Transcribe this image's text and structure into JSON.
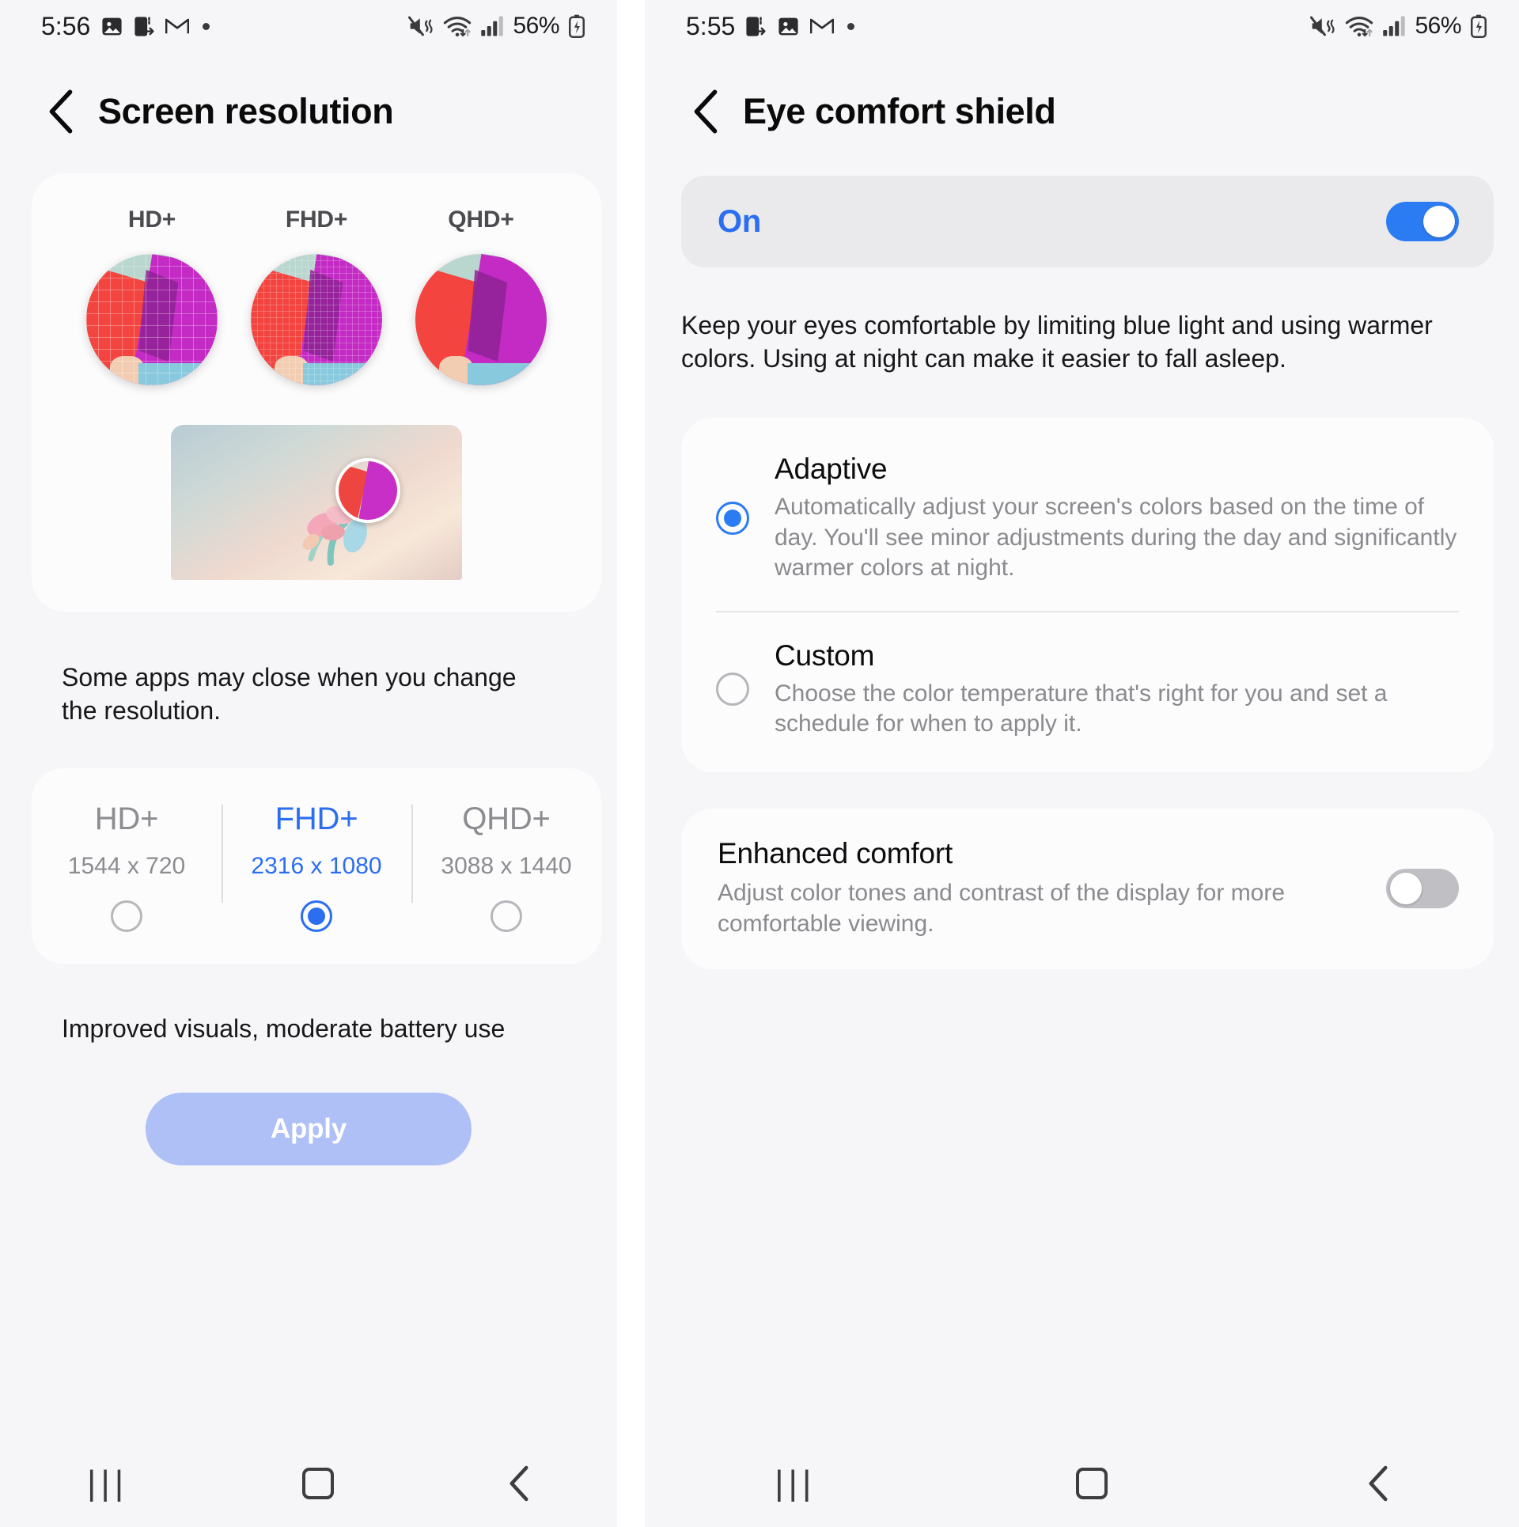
{
  "left": {
    "status_bar": {
      "time": "5:56",
      "icons": [
        "photos-icon",
        "file-transfer-icon",
        "gmail-icon",
        "dot-icon"
      ],
      "right_icons": [
        "mute-vibrate-icon",
        "wifi-icon",
        "signal-icon"
      ],
      "battery": "56%"
    },
    "header": {
      "back": "back-chevron",
      "title": "Screen resolution"
    },
    "previews": [
      {
        "label": "HD+",
        "quality": "hd"
      },
      {
        "label": "FHD+",
        "quality": "fhd"
      },
      {
        "label": "QHD+",
        "quality": "qhd"
      }
    ],
    "notice": "Some apps may close when you change the resolution.",
    "resolutions": [
      {
        "name": "HD+",
        "dims": "1544 x 720",
        "selected": false
      },
      {
        "name": "FHD+",
        "dims": "2316 x 1080",
        "selected": true
      },
      {
        "name": "QHD+",
        "dims": "3088 x 1440",
        "selected": false
      }
    ],
    "hint": "Improved visuals, moderate battery use",
    "apply_label": "Apply",
    "nav": {
      "recents": "|||",
      "home": "home-square",
      "back": "back-chevron"
    }
  },
  "right": {
    "status_bar": {
      "time": "5:55",
      "icons": [
        "file-transfer-icon",
        "photos-icon",
        "gmail-icon",
        "dot-icon"
      ],
      "right_icons": [
        "mute-vibrate-icon",
        "wifi-icon",
        "signal-icon"
      ],
      "battery": "56%"
    },
    "header": {
      "back": "back-chevron",
      "title": "Eye comfort shield"
    },
    "master_toggle": {
      "label": "On",
      "state": "on"
    },
    "description": "Keep your eyes comfortable by limiting blue light and using warmer colors. Using at night can make it easier to fall asleep.",
    "modes": [
      {
        "title": "Adaptive",
        "sub": "Automatically adjust your screen's colors based on the time of day. You'll see minor adjustments during the day and significantly warmer colors at night.",
        "selected": true
      },
      {
        "title": "Custom",
        "sub": "Choose the color temperature that's right for you and set a schedule for when to apply it.",
        "selected": false
      }
    ],
    "enhanced_comfort": {
      "title": "Enhanced comfort",
      "sub": "Adjust color tones and contrast of the display for more comfortable viewing.",
      "state": "off"
    },
    "nav": {
      "recents": "|||",
      "home": "home-square",
      "back": "back-chevron"
    }
  },
  "colors": {
    "accent_blue": "#2b6ef0",
    "toggle_blue": "#2b7cf2",
    "apply_button": "#aec0f5",
    "background": "#f6f6f8",
    "card": "#fcfcfd",
    "muted_text": "#8a8a8f"
  }
}
